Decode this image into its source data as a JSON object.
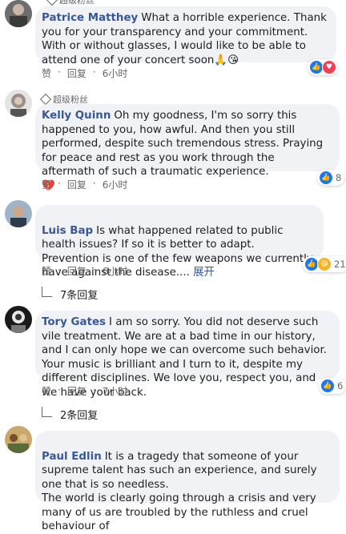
{
  "comments": [
    {
      "author": "Patrice Matthey",
      "text": "What a horrible experience. Thank you for your transparency and your commitment. With or without glasses, I would like to be able to attend one of your concert soon",
      "emoji": "🙏😘",
      "actions": {
        "like": "赞",
        "reply": "回复",
        "time": "6小时"
      },
      "reactions": {
        "icons": [
          "like",
          "love"
        ],
        "count": ""
      }
    },
    {
      "badge": "超级粉丝",
      "author": "Kelly Quinn",
      "text": "Oh my goodness, I'm so sorry this happened to you, how awful. And then you still performed, despite such tremendous stress. Praying for peace and rest as you work through the aftermath of such a traumatic experience.",
      "emoji": "💔",
      "actions": {
        "like": "赞",
        "reply": "回复",
        "time": "6小时"
      },
      "reactions": {
        "icons": [
          "like"
        ],
        "count": "8"
      }
    },
    {
      "author": "Luis Bap",
      "text": "Is what happened related to public health issues? If so it is better to adapt.\nPrevention is one of the few weapons we currently have against the disease.... ",
      "more": "展开",
      "actions": {
        "like": "赞",
        "reply": "回复",
        "time": "6小时"
      },
      "reactions": {
        "icons": [
          "like",
          "haha"
        ],
        "count": "21"
      },
      "replies": "7条回复"
    },
    {
      "author": "Tory Gates",
      "text": "I am so sorry. You did not deserve such vile treatment. We are at a bad time in our history, and I can only hope we can overcome such behavior. Your music is brilliant and I turn to it, despite my different disciplines. We love you, respect you, and we have your back.",
      "actions": {
        "like": "赞",
        "reply": "回复",
        "time": "7小时"
      },
      "reactions": {
        "icons": [
          "like"
        ],
        "count": "6"
      },
      "replies": "2条回复"
    },
    {
      "author": "Paul Edlin",
      "text": "It is a tragedy that someone of your supreme talent has such an experience, and surely one that is so needless.\nThe world is clearly going through a crisis and very many of us are troubled by the ruthless and cruel behaviour of"
    }
  ],
  "top_badge": "超级粉丝"
}
